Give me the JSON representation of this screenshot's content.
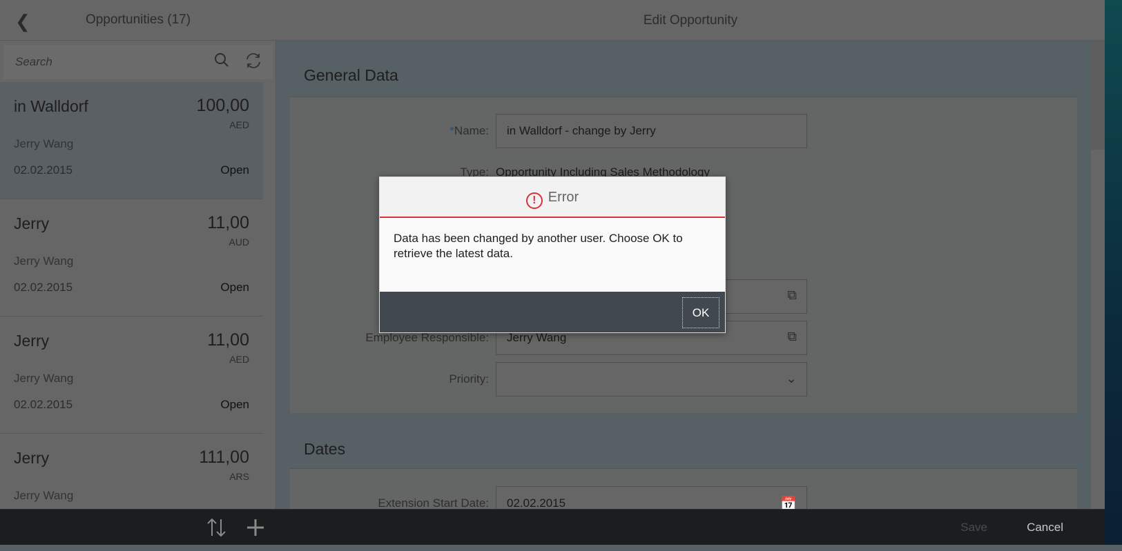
{
  "master": {
    "title": "Opportunities (17)",
    "search_placeholder": "Search",
    "items": [
      {
        "title": "in Walldorf",
        "amount": "100,00",
        "currency": "AED",
        "owner": "Jerry Wang",
        "date": "02.02.2015",
        "status": "Open",
        "selected": true
      },
      {
        "title": "Jerry",
        "amount": "11,00",
        "currency": "AUD",
        "owner": "Jerry Wang",
        "date": "02.02.2015",
        "status": "Open"
      },
      {
        "title": "Jerry",
        "amount": "11,00",
        "currency": "AED",
        "owner": "Jerry Wang",
        "date": "02.02.2015",
        "status": "Open"
      },
      {
        "title": "Jerry",
        "amount": "111,00",
        "currency": "ARS",
        "owner": "Jerry Wang",
        "date": "",
        "status": ""
      }
    ]
  },
  "detail": {
    "title": "Edit Opportunity",
    "general": {
      "heading": "General Data",
      "name_label": "Name:",
      "name_value": "in Walldorf - change by Jerry",
      "type_label": "Type:",
      "type_value": "Opportunity Including Sales Methodology",
      "employee_label": "Employee Responsible:",
      "employee_value": "Jerry Wang",
      "priority_label": "Priority:",
      "priority_value": ""
    },
    "dates": {
      "heading": "Dates",
      "ext_start_label": "Extension Start Date:",
      "ext_start_value": "02.02.2015"
    },
    "footer": {
      "save": "Save",
      "cancel": "Cancel"
    }
  },
  "dialog": {
    "title": "Error",
    "message": "Data has been changed by another user. Choose OK to retrieve the latest data.",
    "ok": "OK"
  },
  "colors": {
    "error": "#d8303a",
    "dialog_footer": "#414850"
  }
}
